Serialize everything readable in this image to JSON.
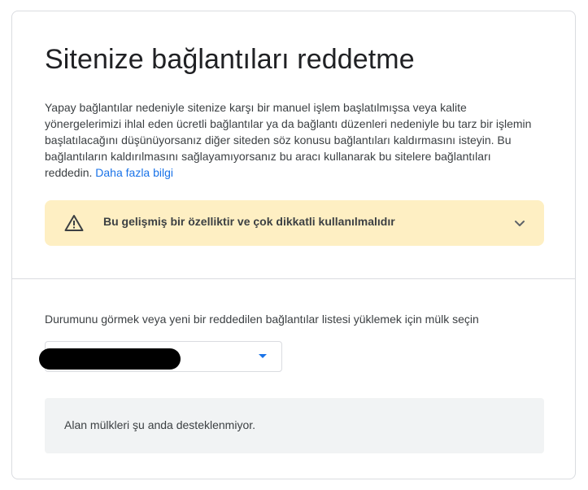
{
  "page": {
    "title": "Sitenize bağlantıları reddetme",
    "description": "Yapay bağlantılar nedeniyle sitenize karşı bir manuel işlem başlatılmışsa veya kalite yönergelerimizi ihlal eden ücretli bağlantılar ya da bağlantı düzenleri nedeniyle bu tarz bir işlemin başlatılacağını düşünüyorsanız diğer siteden söz konusu bağlantıları kaldırmasını isteyin. Bu bağlantıların kaldırılmasını sağlayamıyorsanız bu aracı kullanarak bu sitelere bağlantıları reddedin.",
    "learn_more_link": "Daha fazla bilgi"
  },
  "warning": {
    "text": "Bu gelişmiş bir özelliktir ve çok dikkatli kullanılmalıdır",
    "icon": "warning-triangle-icon",
    "expand_icon": "chevron-down-icon",
    "background_color": "#feefc3"
  },
  "property": {
    "prompt": "Durumunu görmek veya yeni bir reddedilen bağlantılar listesi yüklemek için mülk seçin",
    "selected_value": "",
    "dropdown_icon": "dropdown-arrow-icon",
    "accent_color": "#1a73e8"
  },
  "status": {
    "message": "Alan mülkleri şu anda desteklenmiyor."
  }
}
